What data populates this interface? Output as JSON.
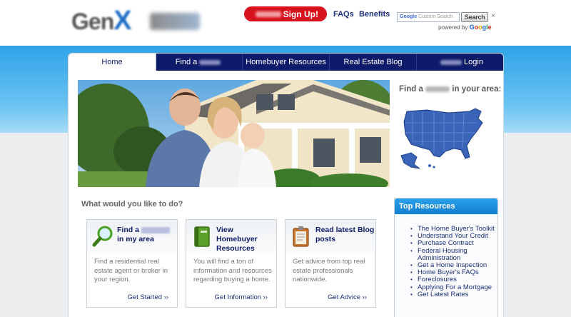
{
  "header": {
    "signup_label": "Sign Up!",
    "faqs_label": "FAQs",
    "benefits_label": "Benefits",
    "logo_text_1": "Gen",
    "logo_text_2": "X",
    "search": {
      "placeholder_prefix": "Google",
      "placeholder": "Custom Search",
      "button_label": "Search",
      "close_label": "×",
      "powered_by": "powered by",
      "google": [
        "G",
        "o",
        "o",
        "g",
        "l",
        "e"
      ]
    }
  },
  "nav": {
    "items": [
      {
        "label": "Home",
        "active": true
      },
      {
        "label_prefix": "Find a",
        "label": ""
      },
      {
        "label": "Homebuyer Resources"
      },
      {
        "label": "Real Estate Blog"
      },
      {
        "label": "Login"
      }
    ]
  },
  "sidebar_find": {
    "title_prefix": "Find a",
    "title_suffix": "in your area:"
  },
  "main": {
    "question": "What would you like to do?",
    "cards": [
      {
        "icon": "magnifier-icon",
        "title_prefix": "Find a",
        "title_suffix": "in my area",
        "desc": "Find a residential real estate agent or broker in your region.",
        "link": "Get Started ››"
      },
      {
        "icon": "book-icon",
        "title": "View Homebuyer Resources",
        "desc": "You will find a ton of information and resources regarding buying a home.",
        "link": "Get Information ››"
      },
      {
        "icon": "notepad-icon",
        "title": "Read latest Blog posts",
        "desc": "Get advice from top real estate professionals nationwide.",
        "link": "Get Advice ››"
      }
    ]
  },
  "top_resources": {
    "title": "Top Resources",
    "items": [
      "The Home Buyer's Toolkit",
      "Understand Your Credit",
      "Purchase Contract",
      "Federal Housing Administration",
      "Get a Home Inspection",
      "Home Buyer's FAQs",
      "Foreclosures",
      "Applying For a Mortgage",
      "Get Latest Rates"
    ]
  },
  "colors": {
    "nav_bg": "#0e1a6a",
    "signup_red": "#d8121d",
    "sky_blue": "#2ea3e8",
    "link_blue": "#1b2f7a"
  }
}
